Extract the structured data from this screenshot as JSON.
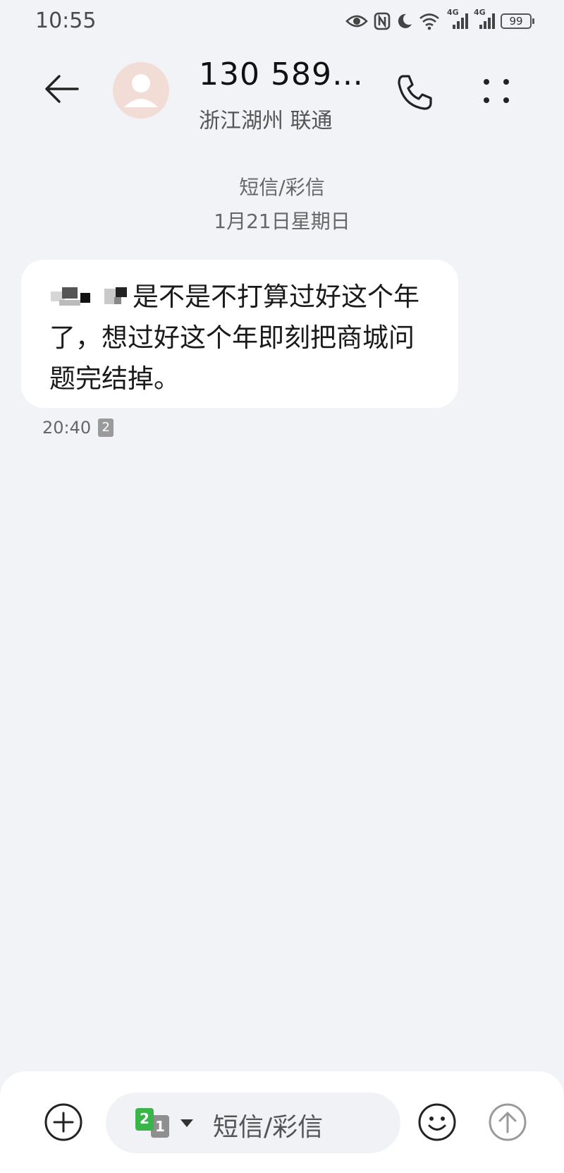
{
  "status_bar": {
    "time": "10:55",
    "network_1": "4G",
    "network_2": "4G",
    "battery": "99",
    "icons": [
      "eye-icon",
      "nfc-icon",
      "moon-icon",
      "wifi-icon",
      "signal-icon",
      "signal-icon",
      "battery-icon"
    ]
  },
  "header": {
    "title": "130 589…",
    "subtitle": "浙江湖州 联通",
    "icons": [
      "back-arrow-icon",
      "avatar-icon",
      "phone-icon",
      "more-vertical-icon"
    ]
  },
  "conversation": {
    "message_type": "短信/彩信",
    "date": "1月21日星期日",
    "messages": [
      {
        "text": "是不是不打算过好这个年了，想过好这个年即刻把商城问题完结掉。",
        "time": "20:40",
        "sim": "2",
        "redacted_prefix": true
      }
    ]
  },
  "composer": {
    "placeholder": "短信/彩信",
    "sim_primary": "2",
    "sim_secondary": "1",
    "icons": [
      "add-circle-icon",
      "sim-select-icon",
      "dropdown-icon",
      "emoji-icon",
      "send-icon"
    ]
  },
  "colors": {
    "background": "#f1f3f6",
    "bubble": "#ffffff",
    "sim_green": "#39b54a",
    "avatar_bg": "#f1dcd6"
  }
}
